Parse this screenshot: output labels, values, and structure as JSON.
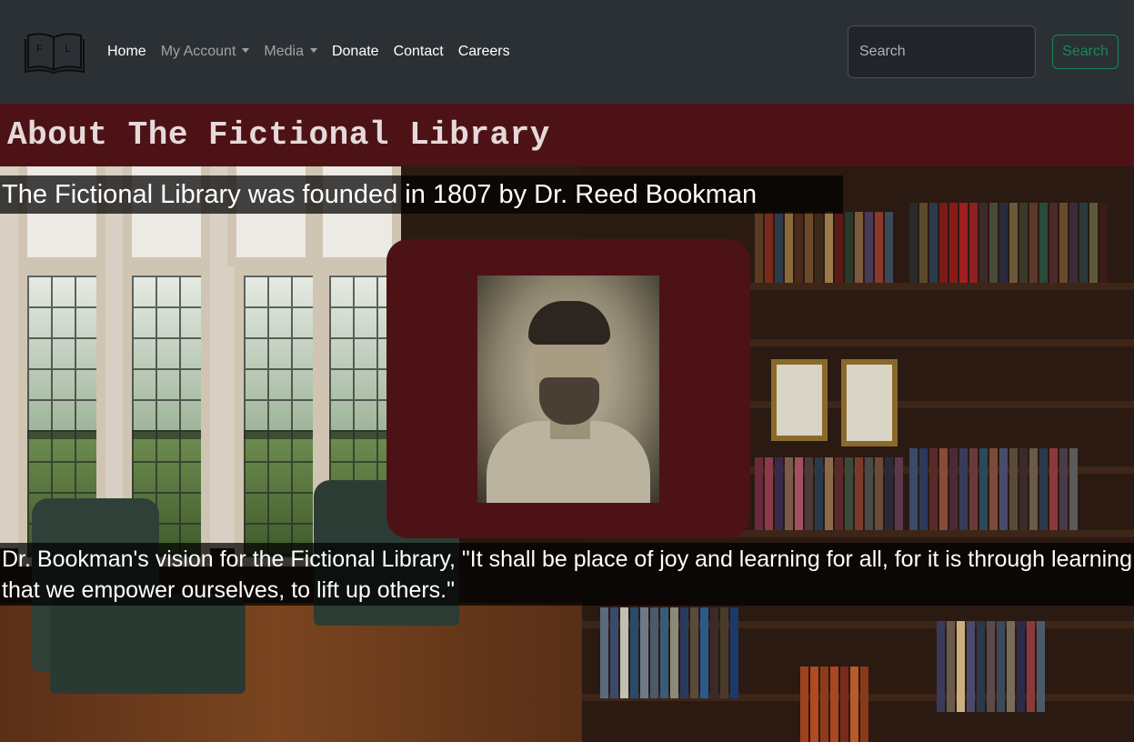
{
  "nav": {
    "logo_letters": "F L",
    "links": [
      {
        "label": "Home"
      },
      {
        "label": "My Account"
      },
      {
        "label": "Media"
      },
      {
        "label": "Donate"
      },
      {
        "label": "Contact"
      },
      {
        "label": "Careers"
      }
    ],
    "search": {
      "placeholder": "Search",
      "button_label": "Search"
    }
  },
  "header": {
    "title": "About The Fictional Library"
  },
  "content": {
    "founding_text": "The Fictional Library was founded in 1807 by Dr. Reed Bookman",
    "vision_text": "Dr. Bookman's vision for the Fictional Library, \"It shall be place of joy and learning for all, for it is through learning that we empower ourselves, to lift up others.\""
  },
  "colors": {
    "navbar": "#2b3035",
    "accent_maroon": "#4d1216",
    "search_green": "#198754"
  }
}
